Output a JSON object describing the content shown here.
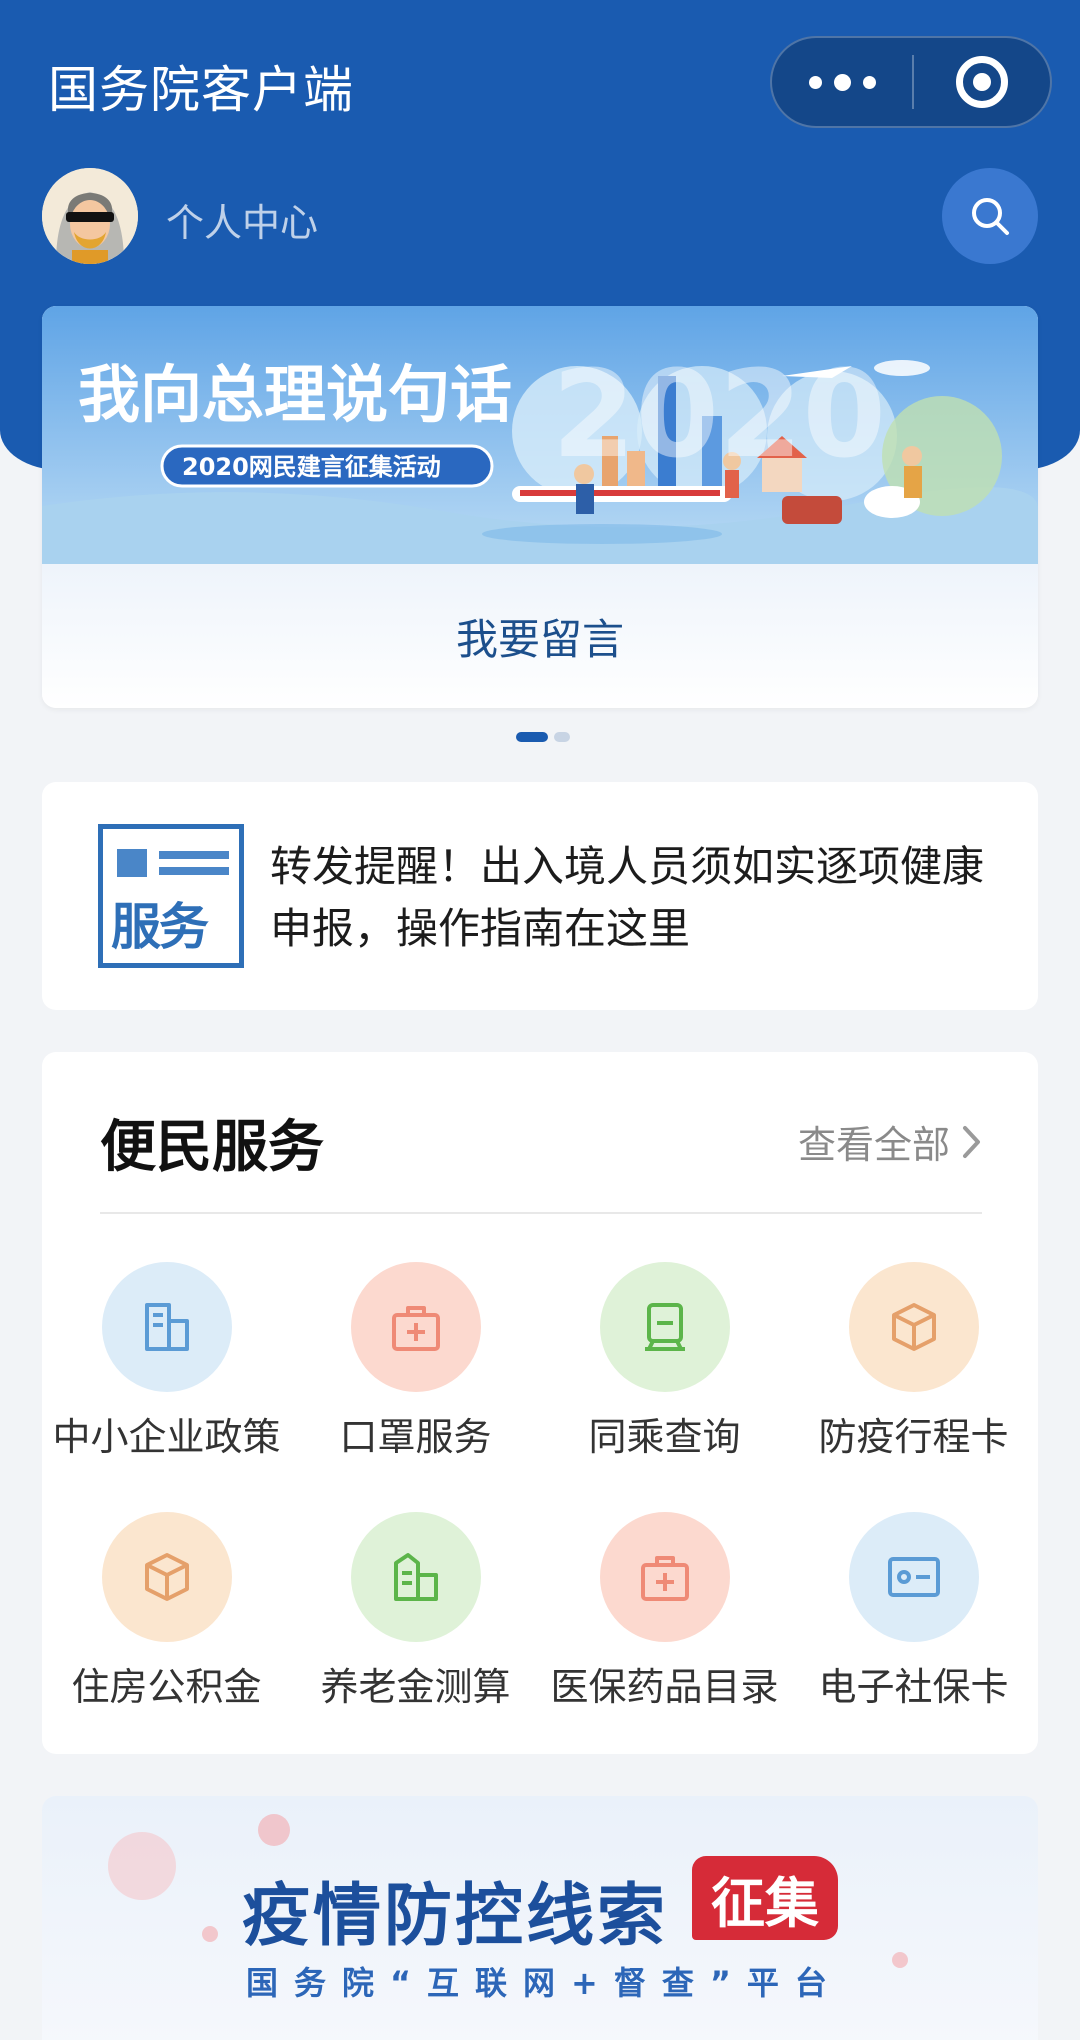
{
  "header": {
    "app_title": "国务院客户端",
    "personal_center": "个人中心"
  },
  "banner": {
    "title_text": "我向总理说句话",
    "subtitle_text": "2020网民建言征集活动",
    "year_text": "2020",
    "action_label": "我要留言",
    "pager": {
      "count": 2,
      "active": 1
    }
  },
  "notice": {
    "icon_text": "服务",
    "text": "转发提醒！出入境人员须如实逐项健康申报，操作指南在这里"
  },
  "services": {
    "title": "便民服务",
    "view_all": "查看全部",
    "items": [
      {
        "label": "中小企业政策",
        "icon": "building-icon",
        "bg": "#dcecf8",
        "fg": "#5b9bd5"
      },
      {
        "label": "口罩服务",
        "icon": "medkit-icon",
        "bg": "#fcd9cf",
        "fg": "#ef8a76"
      },
      {
        "label": "同乘查询",
        "icon": "train-icon",
        "bg": "#dff2d8",
        "fg": "#5cb54a"
      },
      {
        "label": "防疫行程卡",
        "icon": "box-icon",
        "bg": "#fbe6cf",
        "fg": "#e5a06a"
      },
      {
        "label": "住房公积金",
        "icon": "box-icon",
        "bg": "#fbe6cf",
        "fg": "#e5a06a"
      },
      {
        "label": "养老金测算",
        "icon": "buildings-icon",
        "bg": "#dff2d8",
        "fg": "#5cb54a"
      },
      {
        "label": "医保药品目录",
        "icon": "medkit-icon",
        "bg": "#fcd9cf",
        "fg": "#ef8a76"
      },
      {
        "label": "电子社保卡",
        "icon": "id-card-icon",
        "bg": "#dcecf8",
        "fg": "#5b9bd5"
      }
    ]
  },
  "bottom_banner": {
    "title": "疫情防控线索",
    "tag": "征集",
    "subtitle": "国务院“互联网+督查”平台"
  }
}
